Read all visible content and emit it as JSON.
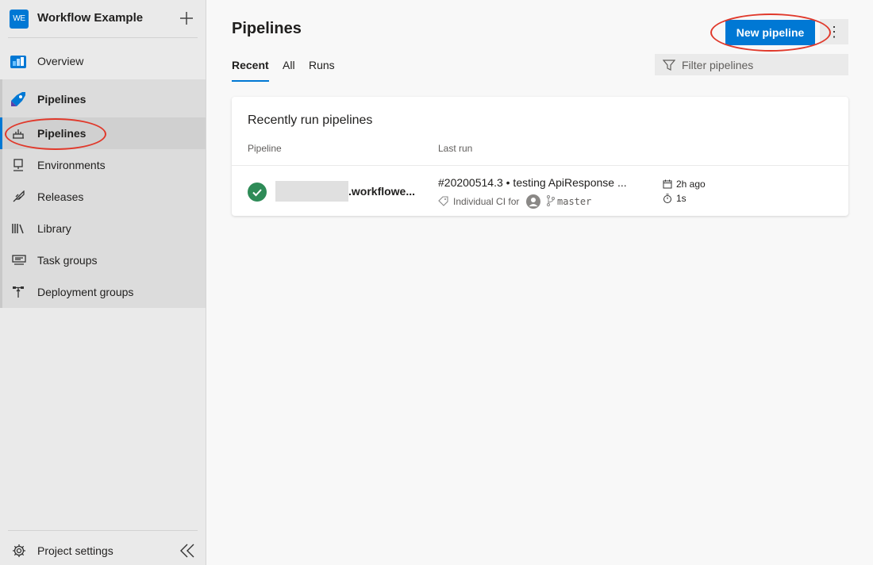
{
  "project": {
    "initials": "WE",
    "name": "Workflow Example"
  },
  "nav": {
    "overview": "Overview",
    "pipelines_group": "Pipelines",
    "items": [
      {
        "label": "Pipelines",
        "icon": "pipelines-icon",
        "selected": true
      },
      {
        "label": "Environments",
        "icon": "environments-icon"
      },
      {
        "label": "Releases",
        "icon": "releases-icon"
      },
      {
        "label": "Library",
        "icon": "library-icon"
      },
      {
        "label": "Task groups",
        "icon": "task-groups-icon"
      },
      {
        "label": "Deployment groups",
        "icon": "deployment-groups-icon"
      }
    ],
    "settings": "Project settings"
  },
  "page": {
    "title": "Pipelines",
    "new_button": "New pipeline",
    "more_button": "⋮",
    "tabs": [
      {
        "label": "Recent",
        "active": true
      },
      {
        "label": "All"
      },
      {
        "label": "Runs"
      }
    ],
    "filter_placeholder": "Filter pipelines"
  },
  "card": {
    "title": "Recently run pipelines",
    "columns": [
      "Pipeline",
      "Last run"
    ],
    "rows": [
      {
        "status": "succeeded",
        "pipeline_name": ".workflowe...",
        "run_title": "#20200514.3 • testing ApiResponse ...",
        "trigger": "Individual CI for",
        "branch": "master",
        "time_ago": "2h ago",
        "duration": "1s"
      }
    ]
  },
  "colors": {
    "accent": "#0078d4",
    "success": "#2e8b57",
    "annotation": "#e0392b"
  }
}
